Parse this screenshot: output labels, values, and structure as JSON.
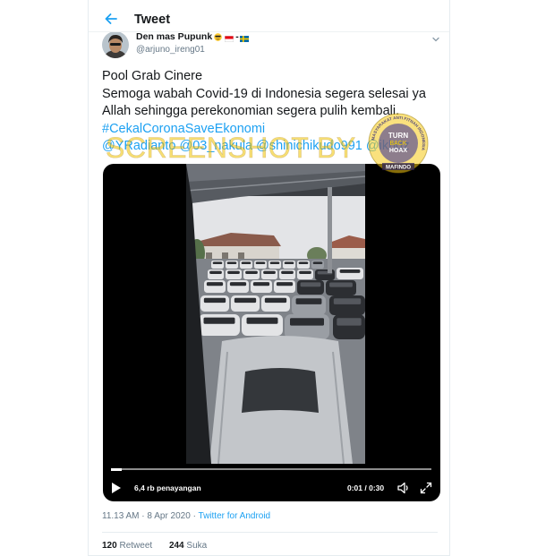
{
  "header": {
    "title": "Tweet",
    "back_icon": "arrow-left-icon"
  },
  "author": {
    "name": "Den mas Pupunk",
    "emoji_icon": "smiling-face-with-sunglasses-icon",
    "flag_icons": [
      "indonesia-flag-icon",
      "sweden-flag-icon"
    ],
    "flag_separator": "-",
    "handle": "@arjuno_ireng01",
    "menu_icon": "chevron-down-icon"
  },
  "tweet": {
    "lines": [
      "Pool Grab Cinere",
      "Semoga wabah Covid-19 di Indonesia segera selesai ya",
      "Allah sehingga perekonomian segera pulih kembali."
    ],
    "hashtag": "#CekalCoronaSaveEkonomi",
    "mentions": [
      "@YRadianto",
      "@03_nakula",
      "@shinichikudo991",
      "@ikhdz"
    ]
  },
  "watermark": {
    "text": "SCREENSHOT BY",
    "logo": {
      "top": "TURN",
      "middle": "BACK",
      "bottom": "HOAX",
      "ring": "MASYARAKAT ANTI FITNAH INDONESIA",
      "banner": "MAFINDO"
    }
  },
  "video": {
    "views": "6,4 rb penayangan",
    "time": "0:01 / 0:30",
    "progress": 0.033,
    "play_icon": "play-icon",
    "volume_icon": "volume-icon",
    "fullscreen_icon": "fullscreen-icon"
  },
  "meta": {
    "time": "11.13 AM",
    "separator": "·",
    "date": "8 Apr 2020",
    "source": "Twitter for Android"
  },
  "stats": {
    "retweets": "120",
    "retweets_label": "Retweet",
    "likes": "244",
    "likes_label": "Suka"
  },
  "colors": {
    "accent": "#1da1f2",
    "text": "#14171a",
    "muted": "#657786",
    "watermark": "#f2c500"
  }
}
